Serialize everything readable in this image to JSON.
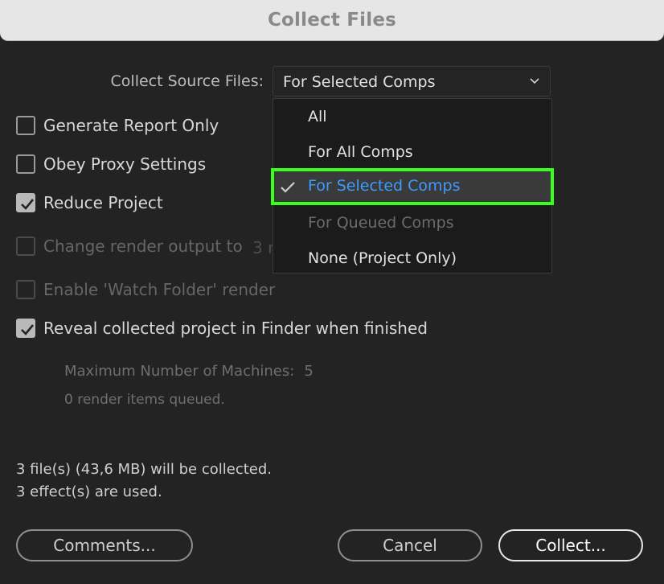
{
  "window": {
    "title": "Collect Files"
  },
  "source": {
    "label": "Collect Source Files:",
    "selected": "For Selected Comps",
    "options": [
      {
        "label": "All",
        "state": "normal"
      },
      {
        "label": "For All Comps",
        "state": "normal"
      },
      {
        "label": "For Selected Comps",
        "state": "selected"
      },
      {
        "label": "For Queued Comps",
        "state": "disabled"
      },
      {
        "label": "None (Project Only)",
        "state": "normal"
      }
    ]
  },
  "options": {
    "generate_report": {
      "label": "Generate Report Only",
      "checked": false
    },
    "obey_proxy": {
      "label": "Obey Proxy Settings",
      "checked": false
    },
    "reduce_project": {
      "label": "Reduce Project",
      "checked": true
    },
    "change_render": {
      "label": "Change render output to",
      "checked": false,
      "trailing": "3 r"
    },
    "watch_folder": {
      "label": "Enable 'Watch Folder' render",
      "checked": false
    },
    "reveal": {
      "label": "Reveal collected project in Finder when finished",
      "checked": true
    }
  },
  "machines": {
    "label": "Maximum Number of Machines:",
    "value": "5"
  },
  "queued": "0 render items queued.",
  "summary": {
    "files": "3 file(s) (43,6 MB) will be collected.",
    "effects": "3 effect(s) are used."
  },
  "buttons": {
    "comments": "Comments...",
    "cancel": "Cancel",
    "collect": "Collect..."
  },
  "colors": {
    "highlight_outline": "#3bff1f",
    "selected_text": "#3d9bff",
    "background": "#232323"
  }
}
